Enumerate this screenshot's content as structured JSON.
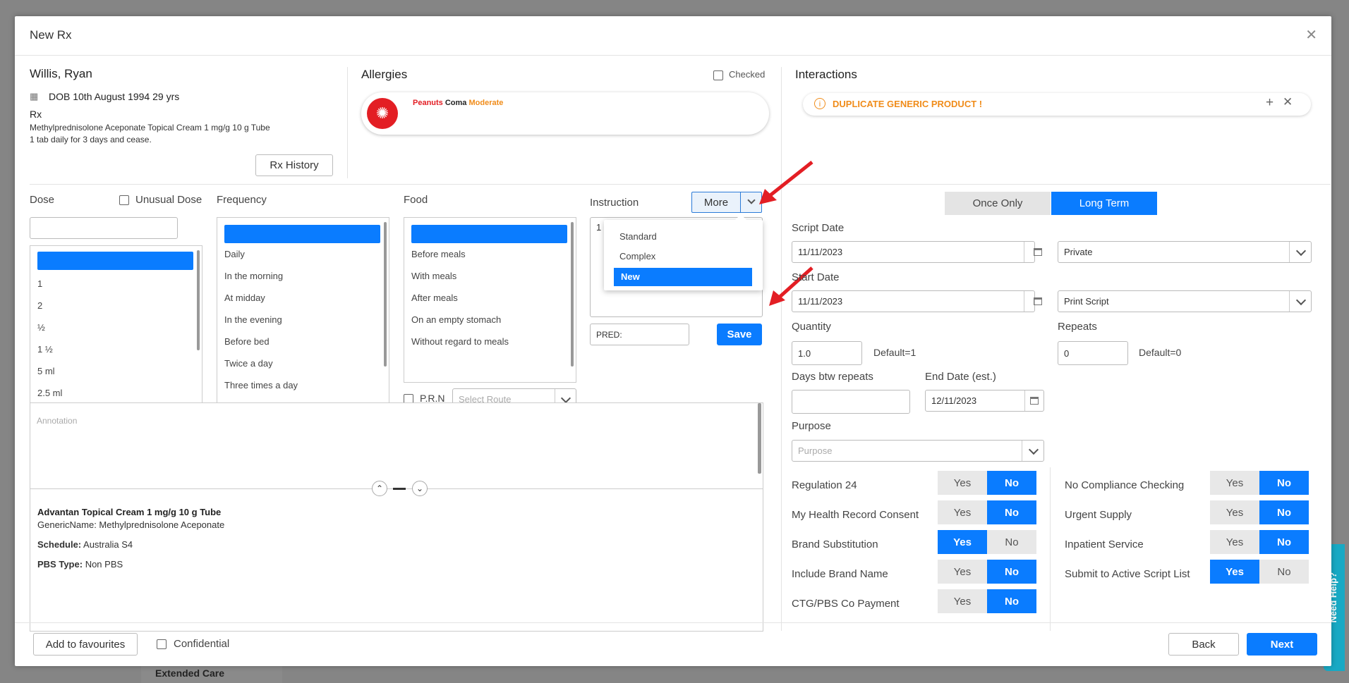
{
  "modal": {
    "title": "New Rx"
  },
  "patient": {
    "name": "Willis, Ryan",
    "dob": "DOB 10th August 1994 29 yrs",
    "rx_label": "Rx",
    "rx_drug": "Methylprednisolone Aceponate Topical Cream 1 mg/g 10 g Tube",
    "rx_instruction": "1 tab daily for 3 days and cease.",
    "history_button": "Rx History"
  },
  "allergies": {
    "title": "Allergies",
    "checked_label": "Checked",
    "allergen": "Peanuts",
    "reaction": "Coma",
    "severity": "Moderate"
  },
  "interactions": {
    "title": "Interactions",
    "alert": "DUPLICATE GENERIC PRODUCT !"
  },
  "dose": {
    "title": "Dose",
    "unusual_label": "Unusual Dose",
    "items": [
      "1",
      "2",
      "½",
      "1 ½",
      "5 ml",
      "2.5 ml"
    ]
  },
  "frequency": {
    "title": "Frequency",
    "items": [
      "Daily",
      "In the morning",
      "At midday",
      "In the evening",
      "Before bed",
      "Twice a day",
      "Three times a day"
    ]
  },
  "food": {
    "title": "Food",
    "items": [
      "Before meals",
      "With meals",
      "After meals",
      "On an empty stomach",
      "Without regard to meals"
    ],
    "prn_label": "P.R.N",
    "route_placeholder": "Select Route"
  },
  "instruction": {
    "title": "Instruction",
    "more_label": "More",
    "text_preview": "1",
    "menu": [
      "Standard",
      "Complex",
      "New"
    ],
    "selected_menu": "New",
    "pred_value": "PRED:",
    "save_label": "Save"
  },
  "annotation": {
    "placeholder": "Annotation"
  },
  "drug_info": {
    "name": "Advantan Topical Cream 1 mg/g 10 g Tube",
    "generic_prefix": "GenericName: ",
    "generic": "Methylprednisolone Aceponate",
    "schedule_label": "Schedule:",
    "schedule": "Australia S4",
    "pbs_label": "PBS Type:",
    "pbs": "Non PBS"
  },
  "term": {
    "once": "Once Only",
    "long": "Long Term",
    "selected": "Long Term"
  },
  "script": {
    "script_date_label": "Script Date",
    "script_date": "11/11/2023",
    "script_type": "Private",
    "start_date_label": "Start Date",
    "start_date": "11/11/2023",
    "print_type": "Print Script",
    "quantity_label": "Quantity",
    "quantity": "1.0",
    "quantity_default": "Default=1",
    "repeats_label": "Repeats",
    "repeats": "0",
    "repeats_default": "Default=0",
    "days_label": "Days btw repeats",
    "end_label": "End Date (est.)",
    "end_date": "12/11/2023",
    "purpose_label": "Purpose",
    "purpose_placeholder": "Purpose"
  },
  "toggles_left": [
    {
      "label": "Regulation 24",
      "value": "No"
    },
    {
      "label": "My Health Record Consent",
      "value": "No"
    },
    {
      "label": "Brand Substitution",
      "value": "Yes"
    },
    {
      "label": "Include Brand Name",
      "value": "No"
    },
    {
      "label": "CTG/PBS Co Payment",
      "value": "No"
    }
  ],
  "toggles_right": [
    {
      "label": "No Compliance Checking",
      "value": "No"
    },
    {
      "label": "Urgent Supply",
      "value": "No"
    },
    {
      "label": "Inpatient Service",
      "value": "No"
    },
    {
      "label": "Submit to Active Script List",
      "value": "Yes"
    }
  ],
  "yes_label": "Yes",
  "no_label": "No",
  "footer": {
    "favourites": "Add to favourites",
    "confidential": "Confidential",
    "back": "Back",
    "next": "Next"
  },
  "background": {
    "extended_care": "Extended Care",
    "need_help": "Need Help?"
  },
  "colors": {
    "primary": "#0a7cff",
    "warning": "#f08c1a",
    "danger": "#e31e24"
  }
}
